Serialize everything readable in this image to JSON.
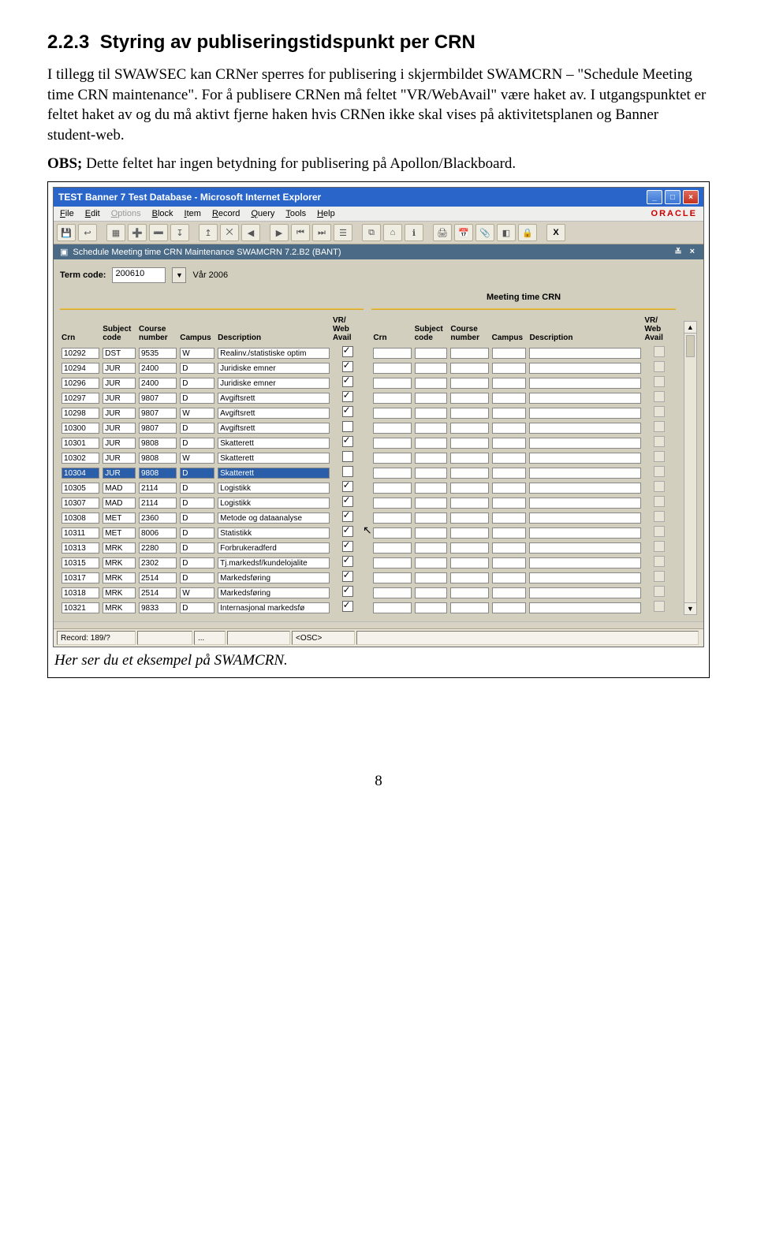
{
  "section": {
    "number": "2.2.3",
    "title": "Styring av publiseringstidspunkt per CRN"
  },
  "paragraphs": {
    "p1": "I tillegg til SWAWSEC kan CRNer sperres for publisering i skjermbildet SWAMCRN – \"Schedule Meeting time CRN maintenance\". For å publisere CRNen må feltet \"VR/WebAvail\" være haket av. I utgangspunktet er feltet haket av og du må aktivt fjerne haken hvis CRNen ikke skal vises på aktivitetsplanen og Banner student-web.",
    "p2_lead": "OBS;",
    "p2_rest": " Dette feltet har ingen betydning for publisering på Apollon/Blackboard."
  },
  "window": {
    "title": "TEST Banner 7 Test Database - Microsoft Internet Explorer",
    "menu": {
      "file": "File",
      "edit": "Edit",
      "options": "Options",
      "block": "Block",
      "item": "Item",
      "record": "Record",
      "query": "Query",
      "tools": "Tools",
      "help": "Help"
    },
    "brand": "ORACLE",
    "toolbar_icons": [
      "save-icon",
      "rollback-icon",
      "select-icon",
      "insert-icon",
      "delete-icon",
      "enter-query-icon",
      "execute-query-icon",
      "cancel-query-icon",
      "prev-record-icon",
      "next-record-icon",
      "prev-block-icon",
      "next-block-icon",
      "view-icon",
      "list-icon",
      "tree-icon",
      "help-icon",
      "print-icon",
      "calendar-icon",
      "attach-icon",
      "extra-icon",
      "lock-icon",
      "exit-icon"
    ],
    "subtitle": "Schedule Meeting time CRN Maintenance  SWAMCRN  7.2.B2 (BANT)",
    "term": {
      "label": "Term code:",
      "value": "200610",
      "desc": "Vår 2006"
    },
    "group_left_heading": "",
    "group_right_heading": "Meeting time CRN",
    "columns": {
      "crn": "Crn",
      "subj": "Subject code",
      "course": "Course number",
      "campus": "Campus",
      "desc": "Description",
      "vr": "VR/ Web Avail"
    },
    "rows_left": [
      {
        "crn": "10292",
        "subj": "DST",
        "course": "9535",
        "campus": "W",
        "desc": "Realinv./statistiske optim",
        "vr": true
      },
      {
        "crn": "10294",
        "subj": "JUR",
        "course": "2400",
        "campus": "D",
        "desc": "Juridiske emner",
        "vr": true
      },
      {
        "crn": "10296",
        "subj": "JUR",
        "course": "2400",
        "campus": "D",
        "desc": "Juridiske emner",
        "vr": true
      },
      {
        "crn": "10297",
        "subj": "JUR",
        "course": "9807",
        "campus": "D",
        "desc": "Avgiftsrett",
        "vr": true
      },
      {
        "crn": "10298",
        "subj": "JUR",
        "course": "9807",
        "campus": "W",
        "desc": "Avgiftsrett",
        "vr": true
      },
      {
        "crn": "10300",
        "subj": "JUR",
        "course": "9807",
        "campus": "D",
        "desc": "Avgiftsrett",
        "vr": false
      },
      {
        "crn": "10301",
        "subj": "JUR",
        "course": "9808",
        "campus": "D",
        "desc": "Skatterett",
        "vr": true
      },
      {
        "crn": "10302",
        "subj": "JUR",
        "course": "9808",
        "campus": "W",
        "desc": "Skatterett",
        "vr": false
      },
      {
        "crn": "10304",
        "subj": "JUR",
        "course": "9808",
        "campus": "D",
        "desc": "Skatterett",
        "vr": false,
        "selected": true
      },
      {
        "crn": "10305",
        "subj": "MAD",
        "course": "2114",
        "campus": "D",
        "desc": "Logistikk",
        "vr": true
      },
      {
        "crn": "10307",
        "subj": "MAD",
        "course": "2114",
        "campus": "D",
        "desc": "Logistikk",
        "vr": true
      },
      {
        "crn": "10308",
        "subj": "MET",
        "course": "2360",
        "campus": "D",
        "desc": "Metode og dataanalyse",
        "vr": true
      },
      {
        "crn": "10311",
        "subj": "MET",
        "course": "8006",
        "campus": "D",
        "desc": "Statistikk",
        "vr": true,
        "cursor": true
      },
      {
        "crn": "10313",
        "subj": "MRK",
        "course": "2280",
        "campus": "D",
        "desc": "Forbrukeradferd",
        "vr": true
      },
      {
        "crn": "10315",
        "subj": "MRK",
        "course": "2302",
        "campus": "D",
        "desc": "Tj.markedsf/kundelojalite",
        "vr": true
      },
      {
        "crn": "10317",
        "subj": "MRK",
        "course": "2514",
        "campus": "D",
        "desc": "Markedsføring",
        "vr": true
      },
      {
        "crn": "10318",
        "subj": "MRK",
        "course": "2514",
        "campus": "W",
        "desc": "Markedsføring",
        "vr": true
      },
      {
        "crn": "10321",
        "subj": "MRK",
        "course": "9833",
        "campus": "D",
        "desc": "Internasjonal markedsfø",
        "vr": true
      }
    ],
    "status": {
      "record_label": "Record: 189/?",
      "ellipsis": "...",
      "osc": "<OSC>"
    }
  },
  "caption": "Her ser du et eksempel på SWAMCRN.",
  "page_number": "8"
}
